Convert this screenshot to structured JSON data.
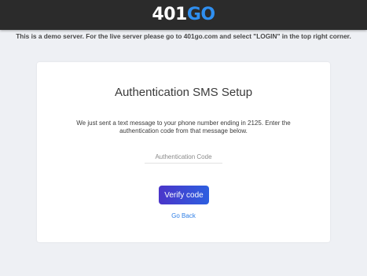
{
  "header": {
    "logo_number": "401",
    "logo_go": "GO"
  },
  "banner": {
    "text": "This is a demo server. For the live server please go to 401go.com and select \"LOGIN\" in the top right corner."
  },
  "auth": {
    "title": "Authentication SMS Setup",
    "instructions": "We just sent a text message to your phone number ending in 2125. Enter the authentication code from that message below.",
    "code_placeholder": "Authentication Code",
    "code_value": "",
    "verify_label": "Verify code",
    "back_label": "Go Back"
  }
}
